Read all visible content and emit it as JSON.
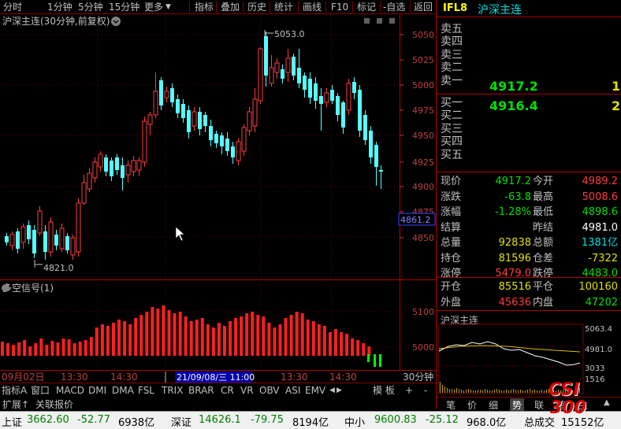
{
  "toolbar": {
    "items": [
      "分时",
      "1分钟",
      "5分钟",
      "15分钟",
      "更多",
      "指标",
      "叠加",
      "历史",
      "统计",
      "画线",
      "F10",
      "标记",
      "-自选",
      "返回"
    ]
  },
  "main_chart": {
    "title": "沪深主连(30分钟,前复权)",
    "high_label": "5053.0",
    "low_label": "4821.0",
    "price_box": "4861.2",
    "y_ticks": [
      "5050",
      "5025",
      "5000",
      "4975",
      "4950",
      "4925",
      "4900",
      "4875",
      "4850"
    ]
  },
  "indicator_panel": {
    "title": "多空信号(1)",
    "y_ticks": [
      "5100",
      "5000"
    ]
  },
  "time_axis": {
    "labels": [
      "09月02日",
      "13:30",
      "14:30",
      "13:30",
      "14:30"
    ],
    "cursor_label": "21/09/08/三 11:00",
    "period": "30分钟"
  },
  "bottom_tabs": [
    "指标A",
    "窗口",
    "MACD",
    "DMI",
    "DMA",
    "FSL",
    "TRIX",
    "BRAR",
    "CR",
    "VR",
    "OBV",
    "ASI",
    "EMV",
    "模 板",
    "+",
    "-"
  ],
  "bottom_subtabs": [
    "扩展↑",
    "关联报价"
  ],
  "right_panel": {
    "code": "IFL8",
    "name": "沪深主连",
    "sell_labels": [
      "卖五",
      "卖四",
      "卖三",
      "卖二",
      "卖一"
    ],
    "sell1_price": "4917.2",
    "sell1_vol": "1",
    "buy_labels": [
      "买一",
      "买二",
      "买三",
      "买四",
      "买五"
    ],
    "buy1_price": "4916.4",
    "buy1_vol": "2",
    "quote_rows": [
      {
        "l1": "现价",
        "v1": "4917.2",
        "c1": "#00e000",
        "l2": "今开",
        "v2": "4989.2",
        "c2": "#ff3c3c"
      },
      {
        "l1": "涨跌",
        "v1": "-63.8",
        "c1": "#00e000",
        "l2": "最高",
        "v2": "5008.6",
        "c2": "#ff3c3c"
      },
      {
        "l1": "涨幅",
        "v1": "-1.28%",
        "c1": "#00e000",
        "l2": "最低",
        "v2": "4898.6",
        "c2": "#00e000"
      },
      {
        "l1": "结算",
        "v1": "",
        "c1": "#ffffff",
        "l2": "昨结",
        "v2": "4981.0",
        "c2": "#ffffff"
      },
      {
        "l1": "总量",
        "v1": "92838",
        "c1": "#e0e000",
        "l2": "总额",
        "v2": "1381亿",
        "c2": "#00e0e0"
      },
      {
        "l1": "持仓",
        "v1": "81596",
        "c1": "#e0e000",
        "l2": "仓差",
        "v2": "-7322",
        "c2": "#e0e000"
      },
      {
        "l1": "涨停",
        "v1": "5479.0",
        "c1": "#ff3c3c",
        "l2": "跌停",
        "v2": "4483.0",
        "c2": "#00e000"
      }
    ],
    "trade_rows": [
      {
        "l1": "开仓",
        "v1": "85516",
        "c1": "#e0e000",
        "l2": "平仓",
        "v2": "100160",
        "c2": "#e0e000"
      },
      {
        "l1": "外盘",
        "v1": "45636",
        "c1": "#ff3c3c",
        "l2": "内盘",
        "v2": "47202",
        "c2": "#00e000"
      }
    ],
    "mini_title": "沪深主连",
    "mini_ticks": [
      "5063.4",
      "4981.0",
      "3033",
      "1516"
    ],
    "mini_tabs": [
      "笔",
      "价",
      "细",
      "势",
      "联",
      "值",
      "主"
    ],
    "logo_top": "CSI",
    "logo_bottom": "300"
  },
  "status_bar": {
    "items": [
      {
        "name": "上证",
        "price": "3662.60",
        "change": "-52.77",
        "amount": "6938亿"
      },
      {
        "name": "深证",
        "price": "14626.1",
        "change": "-79.75",
        "amount": "8194亿"
      },
      {
        "name": "中小",
        "price": "9600.83",
        "change": "-25.12",
        "amount": "968.0亿"
      },
      {
        "name": "总成交",
        "price": "",
        "change": "",
        "amount": "15152亿"
      }
    ]
  }
}
